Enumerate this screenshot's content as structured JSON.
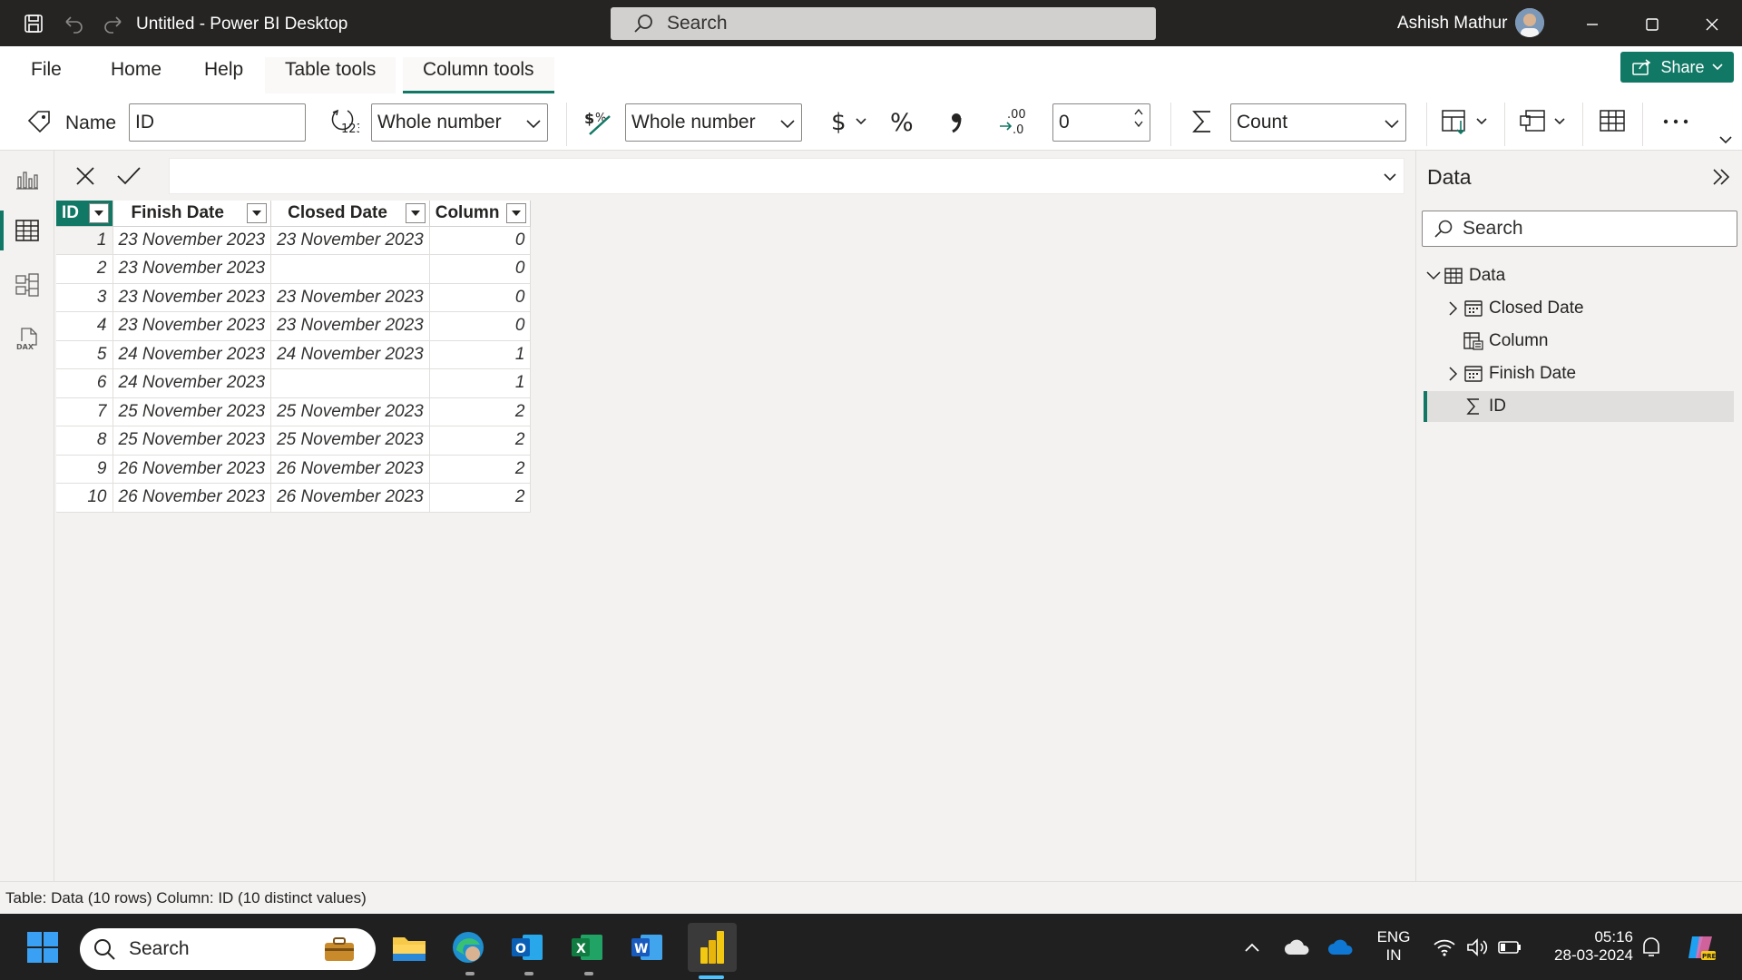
{
  "window": {
    "title": "Untitled - Power BI Desktop",
    "search_placeholder": "Search",
    "user_name": "Ashish Mathur"
  },
  "ribbon": {
    "tabs": [
      {
        "label": "File"
      },
      {
        "label": "Home"
      },
      {
        "label": "Help"
      },
      {
        "label": "Table tools"
      },
      {
        "label": "Column tools"
      }
    ],
    "active_tab": "Column tools",
    "share_label": "Share",
    "name_label": "Name",
    "name_value": "ID",
    "data_type": "Whole number",
    "format": "Whole number",
    "decimal_places": "0",
    "summarization": "Count"
  },
  "grid": {
    "columns": [
      "ID",
      "Finish Date",
      "Closed Date",
      "Column"
    ],
    "selected_column": "ID",
    "rows": [
      {
        "id": "1",
        "finish": "23 November 2023",
        "closed": "23 November 2023",
        "col": "0"
      },
      {
        "id": "2",
        "finish": "23 November 2023",
        "closed": "",
        "col": "0"
      },
      {
        "id": "3",
        "finish": "23 November 2023",
        "closed": "23 November 2023",
        "col": "0"
      },
      {
        "id": "4",
        "finish": "23 November 2023",
        "closed": "23 November 2023",
        "col": "0"
      },
      {
        "id": "5",
        "finish": "24 November 2023",
        "closed": "24 November 2023",
        "col": "1"
      },
      {
        "id": "6",
        "finish": "24 November 2023",
        "closed": "",
        "col": "1"
      },
      {
        "id": "7",
        "finish": "25 November 2023",
        "closed": "25 November 2023",
        "col": "2"
      },
      {
        "id": "8",
        "finish": "25 November 2023",
        "closed": "25 November 2023",
        "col": "2"
      },
      {
        "id": "9",
        "finish": "26 November 2023",
        "closed": "26 November 2023",
        "col": "2"
      },
      {
        "id": "10",
        "finish": "26 November 2023",
        "closed": "26 November 2023",
        "col": "2"
      }
    ]
  },
  "data_pane": {
    "title": "Data",
    "search_placeholder": "Search",
    "table_name": "Data",
    "fields": [
      {
        "label": "Closed Date",
        "icon": "calendar-icon"
      },
      {
        "label": "Column",
        "icon": "calculated-column-icon"
      },
      {
        "label": "Finish Date",
        "icon": "calendar-icon"
      },
      {
        "label": "ID",
        "icon": "sigma-icon"
      }
    ],
    "selected_field": "ID"
  },
  "status": {
    "text": "Table: Data (10 rows) Column: ID (10 distinct values)"
  },
  "taskbar": {
    "search_placeholder": "Search",
    "language_line1": "ENG",
    "language_line2": "IN",
    "time": "05:16",
    "date": "28-03-2024"
  },
  "colors": {
    "accent": "#117865",
    "titlebar": "#252423",
    "taskbar": "#202020"
  }
}
